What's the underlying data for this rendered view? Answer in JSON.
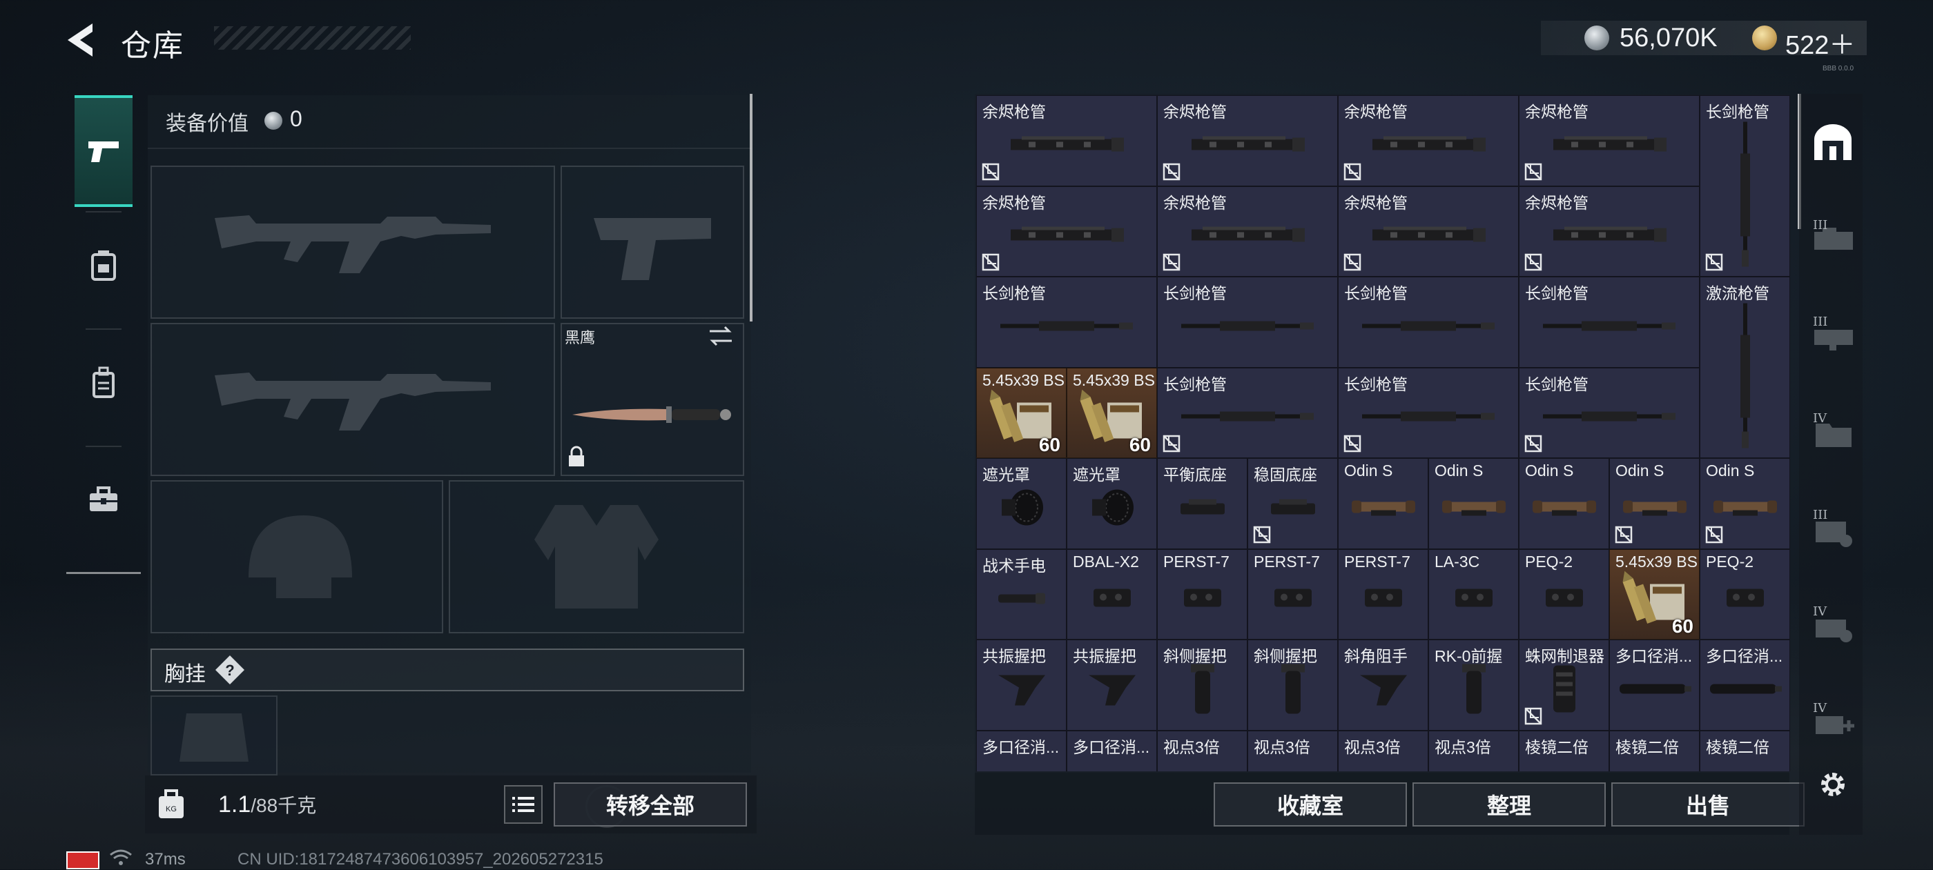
{
  "header": {
    "title": "仓库",
    "silver_amount": "56,070K",
    "gold_amount": "522＋",
    "version": "BBB 0.0.0"
  },
  "equipment": {
    "value_label": "装备价值",
    "value": "0",
    "melee_name": "黑鹰",
    "vest_label": "胸挂",
    "help_symbol": "?"
  },
  "weight": {
    "current": "1.1",
    "max": "/88千克"
  },
  "buttons": {
    "transfer_all": "转移全部",
    "collection": "收藏室",
    "sort": "整理",
    "sell": "出售"
  },
  "status": {
    "ping": "37ms",
    "uid": "CN UID:18172487473606103957_202605272315"
  },
  "rail_numbers": [
    "III",
    "III",
    "IV",
    "III",
    "IV",
    "IV"
  ],
  "grid": {
    "cells": [
      {
        "name": "余烬枪管",
        "col": 0,
        "row": 0,
        "w": 2,
        "h": 1,
        "flag": true,
        "art": "handguard"
      },
      {
        "name": "余烬枪管",
        "col": 2,
        "row": 0,
        "w": 2,
        "h": 1,
        "flag": true,
        "art": "handguard"
      },
      {
        "name": "余烬枪管",
        "col": 4,
        "row": 0,
        "w": 2,
        "h": 1,
        "flag": true,
        "art": "handguard"
      },
      {
        "name": "余烬枪管",
        "col": 6,
        "row": 0,
        "w": 2,
        "h": 1,
        "flag": true,
        "art": "handguard"
      },
      {
        "name": "长剑枪管",
        "col": 8,
        "row": 0,
        "w": 1,
        "h": 2,
        "flag": true,
        "art": "barrel-v"
      },
      {
        "name": "余烬枪管",
        "col": 0,
        "row": 1,
        "w": 2,
        "h": 1,
        "flag": true,
        "art": "handguard"
      },
      {
        "name": "余烬枪管",
        "col": 2,
        "row": 1,
        "w": 2,
        "h": 1,
        "flag": true,
        "art": "handguard"
      },
      {
        "name": "余烬枪管",
        "col": 4,
        "row": 1,
        "w": 2,
        "h": 1,
        "flag": true,
        "art": "handguard"
      },
      {
        "name": "余烬枪管",
        "col": 6,
        "row": 1,
        "w": 2,
        "h": 1,
        "flag": true,
        "art": "handguard"
      },
      {
        "name": "长剑枪管",
        "col": 0,
        "row": 2,
        "w": 2,
        "h": 1,
        "flag": false,
        "art": "barrel"
      },
      {
        "name": "长剑枪管",
        "col": 2,
        "row": 2,
        "w": 2,
        "h": 1,
        "flag": false,
        "art": "barrel"
      },
      {
        "name": "长剑枪管",
        "col": 4,
        "row": 2,
        "w": 2,
        "h": 1,
        "flag": false,
        "art": "barrel"
      },
      {
        "name": "长剑枪管",
        "col": 6,
        "row": 2,
        "w": 2,
        "h": 1,
        "flag": false,
        "art": "barrel"
      },
      {
        "name": "激流枪管",
        "col": 8,
        "row": 2,
        "w": 1,
        "h": 2,
        "flag": false,
        "art": "barrel-v"
      },
      {
        "name": "5.45x39 BS",
        "col": 0,
        "row": 3,
        "w": 1,
        "h": 1,
        "flag": false,
        "art": "ammo",
        "qty": "60",
        "ammo": true
      },
      {
        "name": "5.45x39 BS",
        "col": 1,
        "row": 3,
        "w": 1,
        "h": 1,
        "flag": false,
        "art": "ammo",
        "qty": "60",
        "ammo": true
      },
      {
        "name": "长剑枪管",
        "col": 2,
        "row": 3,
        "w": 2,
        "h": 1,
        "flag": true,
        "art": "barrel"
      },
      {
        "name": "长剑枪管",
        "col": 4,
        "row": 3,
        "w": 2,
        "h": 1,
        "flag": true,
        "art": "barrel"
      },
      {
        "name": "长剑枪管",
        "col": 6,
        "row": 3,
        "w": 2,
        "h": 1,
        "flag": true,
        "art": "barrel"
      },
      {
        "name": "遮光罩",
        "col": 0,
        "row": 4,
        "w": 1,
        "h": 1,
        "flag": false,
        "art": "hood"
      },
      {
        "name": "遮光罩",
        "col": 1,
        "row": 4,
        "w": 1,
        "h": 1,
        "flag": false,
        "art": "hood"
      },
      {
        "name": "平衡底座",
        "col": 2,
        "row": 4,
        "w": 1,
        "h": 1,
        "flag": false,
        "art": "mount"
      },
      {
        "name": "稳固底座",
        "col": 3,
        "row": 4,
        "w": 1,
        "h": 1,
        "flag": true,
        "art": "mount"
      },
      {
        "name": "Odin S",
        "col": 4,
        "row": 4,
        "w": 1,
        "h": 1,
        "flag": false,
        "art": "scope"
      },
      {
        "name": "Odin S",
        "col": 5,
        "row": 4,
        "w": 1,
        "h": 1,
        "flag": false,
        "art": "scope"
      },
      {
        "name": "Odin S",
        "col": 6,
        "row": 4,
        "w": 1,
        "h": 1,
        "flag": false,
        "art": "scope"
      },
      {
        "name": "Odin S",
        "col": 7,
        "row": 4,
        "w": 1,
        "h": 1,
        "flag": true,
        "art": "scope"
      },
      {
        "name": "Odin S",
        "col": 8,
        "row": 4,
        "w": 1,
        "h": 1,
        "flag": true,
        "art": "scope"
      },
      {
        "name": "战术手电",
        "col": 0,
        "row": 5,
        "w": 1,
        "h": 1,
        "flag": false,
        "art": "light"
      },
      {
        "name": "DBAL-X2",
        "col": 1,
        "row": 5,
        "w": 1,
        "h": 1,
        "flag": false,
        "art": "laser"
      },
      {
        "name": "PERST-7",
        "col": 2,
        "row": 5,
        "w": 1,
        "h": 1,
        "flag": false,
        "art": "laser"
      },
      {
        "name": "PERST-7",
        "col": 3,
        "row": 5,
        "w": 1,
        "h": 1,
        "flag": false,
        "art": "laser"
      },
      {
        "name": "PERST-7",
        "col": 4,
        "row": 5,
        "w": 1,
        "h": 1,
        "flag": false,
        "art": "laser"
      },
      {
        "name": "LA-3C",
        "col": 5,
        "row": 5,
        "w": 1,
        "h": 1,
        "flag": false,
        "art": "laser"
      },
      {
        "name": "PEQ-2",
        "col": 6,
        "row": 5,
        "w": 1,
        "h": 1,
        "flag": false,
        "art": "laser"
      },
      {
        "name": "5.45x39 BS",
        "col": 7,
        "row": 5,
        "w": 1,
        "h": 1,
        "flag": false,
        "art": "ammo",
        "qty": "60",
        "ammo": true
      },
      {
        "name": "PEQ-2",
        "col": 8,
        "row": 5,
        "w": 1,
        "h": 1,
        "flag": false,
        "art": "laser"
      },
      {
        "name": "共振握把",
        "col": 0,
        "row": 6,
        "w": 1,
        "h": 1,
        "flag": false,
        "art": "grip"
      },
      {
        "name": "共振握把",
        "col": 1,
        "row": 6,
        "w": 1,
        "h": 1,
        "flag": false,
        "art": "grip"
      },
      {
        "name": "斜侧握把",
        "col": 2,
        "row": 6,
        "w": 1,
        "h": 1,
        "flag": false,
        "art": "vgrip"
      },
      {
        "name": "斜侧握把",
        "col": 3,
        "row": 6,
        "w": 1,
        "h": 1,
        "flag": false,
        "art": "vgrip"
      },
      {
        "name": "斜角阻手",
        "col": 4,
        "row": 6,
        "w": 1,
        "h": 1,
        "flag": false,
        "art": "grip"
      },
      {
        "name": "RK-0前握",
        "col": 5,
        "row": 6,
        "w": 1,
        "h": 1,
        "flag": false,
        "art": "vgrip"
      },
      {
        "name": "蛛网制退器",
        "col": 6,
        "row": 6,
        "w": 1,
        "h": 1,
        "flag": true,
        "art": "brake"
      },
      {
        "name": "多口径消...",
        "col": 7,
        "row": 6,
        "w": 1,
        "h": 1,
        "flag": false,
        "art": "suppressor"
      },
      {
        "name": "多口径消...",
        "col": 8,
        "row": 6,
        "w": 1,
        "h": 1,
        "flag": false,
        "art": "suppressor"
      },
      {
        "name": "多口径消...",
        "col": 0,
        "row": 7,
        "w": 1,
        "h": 1,
        "flag": false,
        "art": "suppressor"
      },
      {
        "name": "多口径消...",
        "col": 1,
        "row": 7,
        "w": 1,
        "h": 1,
        "flag": false,
        "art": "suppressor"
      },
      {
        "name": "视点3倍",
        "col": 2,
        "row": 7,
        "w": 1,
        "h": 1,
        "flag": false,
        "art": "scope"
      },
      {
        "name": "视点3倍",
        "col": 3,
        "row": 7,
        "w": 1,
        "h": 1,
        "flag": false,
        "art": "scope"
      },
      {
        "name": "视点3倍",
        "col": 4,
        "row": 7,
        "w": 1,
        "h": 1,
        "flag": false,
        "art": "scope"
      },
      {
        "name": "视点3倍",
        "col": 5,
        "row": 7,
        "w": 1,
        "h": 1,
        "flag": false,
        "art": "scope"
      },
      {
        "name": "棱镜二倍",
        "col": 6,
        "row": 7,
        "w": 1,
        "h": 1,
        "flag": false,
        "art": "scope"
      },
      {
        "name": "棱镜二倍",
        "col": 7,
        "row": 7,
        "w": 1,
        "h": 1,
        "flag": false,
        "art": "scope"
      },
      {
        "name": "棱镜二倍",
        "col": 8,
        "row": 7,
        "w": 1,
        "h": 1,
        "flag": false,
        "art": "scope"
      }
    ]
  }
}
